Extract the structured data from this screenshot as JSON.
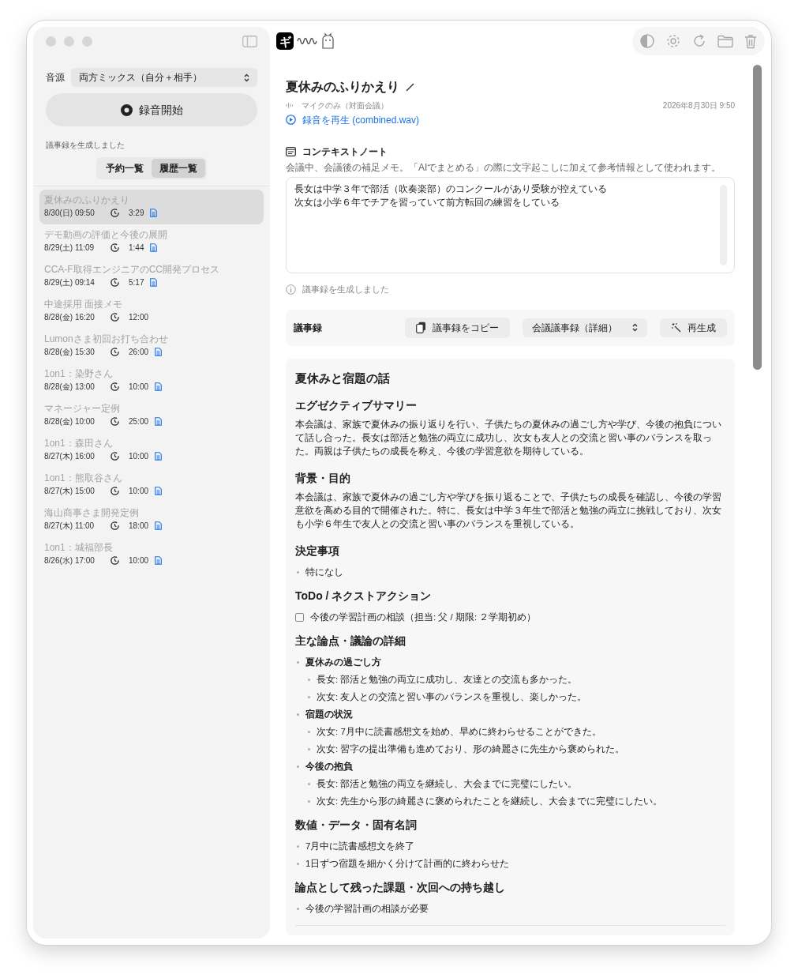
{
  "sidebar": {
    "source_label": "音源",
    "source_value": "両方ミックス（自分＋相手）",
    "record_button": "録音開始",
    "status": "議事録を生成しました",
    "tabs": [
      {
        "label": "予約一覧",
        "selected": false
      },
      {
        "label": "履歴一覧",
        "selected": true
      }
    ],
    "history": [
      {
        "title": "夏休みのふりかえり",
        "date": "8/30(日) 09:50",
        "duration": "3:29",
        "has_minutes": true,
        "selected": true
      },
      {
        "title": "デモ動画の評価と今後の展開",
        "date": "8/29(土) 11:09",
        "duration": "1:44",
        "has_minutes": true,
        "selected": false
      },
      {
        "title": "CCA-F取得エンジニアのCC開発プロセス",
        "date": "8/29(土) 09:14",
        "duration": "5:17",
        "has_minutes": true,
        "selected": false
      },
      {
        "title": "中途採用 面接メモ",
        "date": "8/28(金) 16:20",
        "duration": "12:00",
        "has_minutes": false,
        "selected": false
      },
      {
        "title": "Lumonさま初回お打ち合わせ",
        "date": "8/28(金) 15:30",
        "duration": "26:00",
        "has_minutes": true,
        "selected": false
      },
      {
        "title": "1on1：染野さん",
        "date": "8/28(金) 13:00",
        "duration": "10:00",
        "has_minutes": true,
        "selected": false
      },
      {
        "title": "マネージャー定例",
        "date": "8/28(金) 10:00",
        "duration": "25:00",
        "has_minutes": true,
        "selected": false
      },
      {
        "title": "1on1：森田さん",
        "date": "8/27(木) 16:00",
        "duration": "10:00",
        "has_minutes": true,
        "selected": false
      },
      {
        "title": "1on1：熊取谷さん",
        "date": "8/27(木) 15:00",
        "duration": "10:00",
        "has_minutes": true,
        "selected": false
      },
      {
        "title": "海山商事さま開発定例",
        "date": "8/27(木) 11:00",
        "duration": "18:00",
        "has_minutes": true,
        "selected": false
      },
      {
        "title": "1on1：城福部長",
        "date": "8/26(水) 17:00",
        "duration": "10:00",
        "has_minutes": true,
        "selected": false
      }
    ]
  },
  "header": {
    "logo_text": "ギ"
  },
  "meeting": {
    "title": "夏休みのふりかえり",
    "source": "マイクのみ（対面会議）",
    "datetime": "2026年8月30日 9:50",
    "play_link": "録音を再生 (combined.wav)"
  },
  "context_note": {
    "heading": "コンテキストノート",
    "hint": "会議中、会議後の補足メモ。「AIでまとめる」の際に文字起こしに加えて参考情報として使われます。",
    "lines": [
      "長女は中学３年で部活（吹奏楽部）のコンクールがあり受験が控えている",
      "次女は小学６年でチアを習っていて前方転回の練習をしている"
    ]
  },
  "status": "議事録を生成しました",
  "minutes_bar": {
    "label": "議事録",
    "copy_button": "議事録をコピー",
    "format": "会議議事録（詳細）",
    "regenerate_button": "再生成"
  },
  "minutes": {
    "title": "夏休みと宿題の話",
    "sections": [
      {
        "heading": "エグゼクティブサマリー",
        "kind": "paragraph",
        "text": "本会議は、家族で夏休みの振り返りを行い、子供たちの夏休みの過ごし方や学び、今後の抱負について話し合った。長女は部活と勉強の両立に成功し、次女も友人との交流と習い事のバランスを取った。両親は子供たちの成長を称え、今後の学習意欲を期待している。"
      },
      {
        "heading": "背景・目的",
        "kind": "paragraph",
        "text": "本会議は、家族で夏休みの過ごし方や学びを振り返ることで、子供たちの成長を確認し、今後の学習意欲を高める目的で開催された。特に、長女は中学３年生で部活と勉強の両立に挑戦しており、次女も小学６年生で友人との交流と習い事のバランスを重視している。"
      },
      {
        "heading": "決定事項",
        "kind": "bullets",
        "items": [
          {
            "text": "特になし"
          }
        ]
      },
      {
        "heading": "ToDo / ネクストアクション",
        "kind": "todo",
        "items": [
          {
            "text": "今後の学習計画の相談（担当: 父 / 期限: ２学期初め）",
            "checked": false
          }
        ]
      },
      {
        "heading": "主な論点・議論の詳細",
        "kind": "bullets",
        "items": [
          {
            "text": "夏休みの過ごし方",
            "children": [
              {
                "text": "長女: 部活と勉強の両立に成功し、友達との交流も多かった。"
              },
              {
                "text": "次女: 友人との交流と習い事のバランスを重視し、楽しかった。"
              }
            ]
          },
          {
            "text": "宿題の状況",
            "children": [
              {
                "text": "次女: 7月中に読書感想文を始め、早めに終わらせることができた。"
              },
              {
                "text": "次女: 習字の提出準備も進めており、形の綺麗さに先生から褒められた。"
              }
            ]
          },
          {
            "text": "今後の抱負",
            "children": [
              {
                "text": "長女: 部活と勉強の両立を継続し、大会までに完璧にしたい。"
              },
              {
                "text": "次女: 先生から形の綺麗さに褒められたことを継続し、大会までに完璧にしたい。"
              }
            ]
          }
        ]
      },
      {
        "heading": "数値・データ・固有名詞",
        "kind": "bullets",
        "items": [
          {
            "text": "7月中に読書感想文を終了"
          },
          {
            "text": "1日ずつ宿題を細かく分けて計画的に終わらせた"
          }
        ]
      },
      {
        "heading": "論点として残った課題・次回への持ち越し",
        "kind": "bullets",
        "items": [
          {
            "text": "今後の学習計画の相談が必要"
          }
        ]
      }
    ]
  }
}
